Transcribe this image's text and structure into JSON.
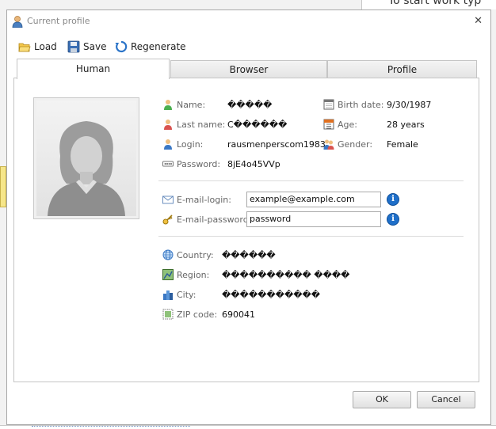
{
  "background": {
    "right_text": "To start work typ"
  },
  "window": {
    "title": "Current profile",
    "close_glyph": "✕"
  },
  "toolbar": {
    "load": "Load",
    "save": "Save",
    "regenerate": "Regenerate"
  },
  "tabs": [
    {
      "label": "Human"
    },
    {
      "label": "Browser"
    },
    {
      "label": "Profile"
    }
  ],
  "human": {
    "name": {
      "label": "Name:",
      "value": "�����"
    },
    "last_name": {
      "label": "Last name:",
      "value": "C������"
    },
    "login": {
      "label": "Login:",
      "value": "rausmenperscom1983"
    },
    "password": {
      "label": "Password:",
      "value": "8jE4o45VVp"
    },
    "birth_date": {
      "label": "Birth date:",
      "value": "9/30/1987"
    },
    "age": {
      "label": "Age:",
      "value": "28 years"
    },
    "gender": {
      "label": "Gender:",
      "value": "Female"
    },
    "email_login": {
      "label": "E-mail-login:",
      "value": "example@example.com"
    },
    "email_password": {
      "label": "E-mail-password:",
      "value": "password"
    },
    "country": {
      "label": "Country:",
      "value": "������"
    },
    "region": {
      "label": "Region:",
      "value": "���������� ����"
    },
    "city": {
      "label": "City:",
      "value": "�����������"
    },
    "zip": {
      "label": "ZIP code:",
      "value": "690041"
    }
  },
  "buttons": {
    "ok": "OK",
    "cancel": "Cancel"
  },
  "colors": {
    "info_blue": "#1f6fc9",
    "panel_border": "#c5c5c5"
  }
}
